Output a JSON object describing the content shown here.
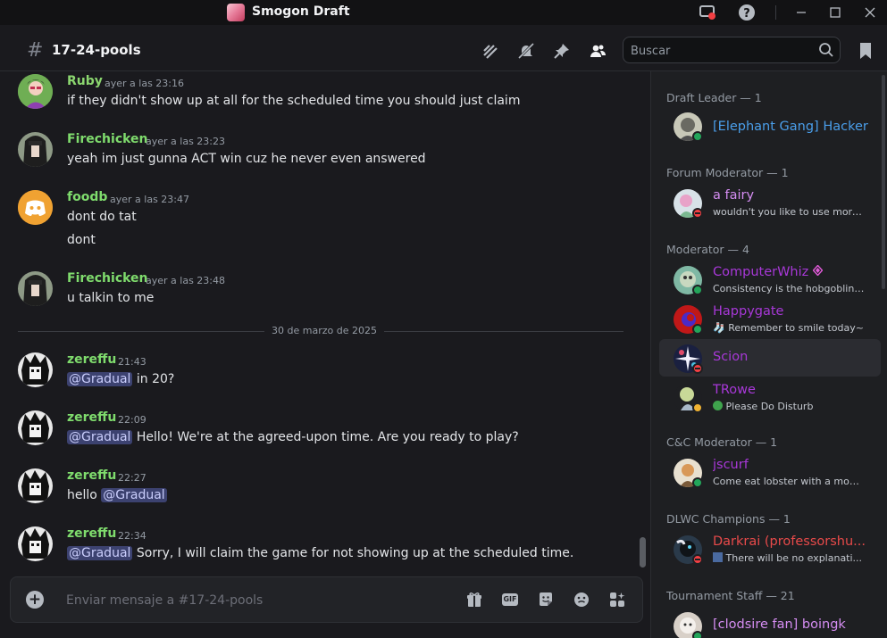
{
  "window": {
    "title": "Smogon Draft"
  },
  "header": {
    "channel": "17-24-pools"
  },
  "search": {
    "placeholder": "Buscar"
  },
  "messages": [
    {
      "author": "Ruby",
      "time": "ayer a las 23:16",
      "lines": [
        "if they didn't show up at all for the scheduled time you should just claim"
      ]
    },
    {
      "author": "Firechicken",
      "time": "ayer a las 23:23",
      "lines": [
        "yeah im just gunna ACT win cuz he never even answered"
      ]
    },
    {
      "author": "foodb",
      "time": "ayer a las 23:47",
      "lines": [
        "dont do tat",
        "dont"
      ]
    },
    {
      "author": "Firechicken",
      "time": "ayer a las 23:48",
      "lines": [
        "u talkin to me"
      ]
    },
    {
      "author": "zereffu",
      "time": "21:43",
      "mention": "@Gradual",
      "text": " in 20?"
    },
    {
      "author": "zereffu",
      "time": "22:09",
      "mention": "@Gradual",
      "text": " Hello! We're at the agreed-upon time. Are you ready to play?"
    },
    {
      "author": "zereffu",
      "time": "22:27",
      "pre": "hello ",
      "mention": "@Gradual",
      "text": ""
    },
    {
      "author": "zereffu",
      "time": "22:34",
      "mention": "@Gradual",
      "text": " Sorry, I will claim the game for not showing up at the scheduled time."
    }
  ],
  "date_divider": "30 de marzo de 2025",
  "composer": {
    "placeholder": "Enviar mensaje a #17-24-pools",
    "gif_label": "GIF"
  },
  "member_groups": [
    {
      "title": "Draft Leader — 1",
      "members": [
        {
          "name": "[Elephant Gang] Hacker",
          "color": "#4a9eea",
          "status": "online",
          "sub": ""
        }
      ]
    },
    {
      "title": "Forum Moderator — 1",
      "members": [
        {
          "name": "a fairy",
          "color": "#d58df2",
          "status": "dnd",
          "sub": "wouldn't you like to use more ..."
        }
      ]
    },
    {
      "title": "Moderator — 4",
      "members": [
        {
          "name": "ComputerWhiz",
          "color": "#a838d8",
          "status": "online",
          "sub": "Consistency is the hobgoblin ..."
        },
        {
          "name": "Happygate",
          "color": "#a838d8",
          "status": "online",
          "sub": "Remember to smile today~"
        },
        {
          "name": "Scion",
          "color": "#a838d8",
          "status": "dnd",
          "sub": ""
        },
        {
          "name": "TRowe",
          "color": "#a838d8",
          "status": "idle",
          "sub": "Please Do Disturb"
        }
      ]
    },
    {
      "title": "C&C Moderator — 1",
      "members": [
        {
          "name": "jscurf",
          "color": "#a838d8",
          "status": "online",
          "sub": "Come eat lobster with a mons..."
        }
      ]
    },
    {
      "title": "DLWC Champions — 1",
      "members": [
        {
          "name": "Darkrai (professorshu...",
          "color": "#e84a4a",
          "status": "dnd",
          "sub": "There will be no explanati..."
        }
      ]
    },
    {
      "title": "Tournament Staff — 21",
      "members": [
        {
          "name": "[clodsire fan] boingk",
          "color": "#d58df2",
          "status": "online",
          "sub": ""
        }
      ]
    }
  ],
  "colors": {
    "author_green": "#7fdc6d",
    "mention_bg": "#3c4270",
    "online": "#23a55a",
    "dnd": "#f23f43",
    "idle": "#f0b232"
  }
}
